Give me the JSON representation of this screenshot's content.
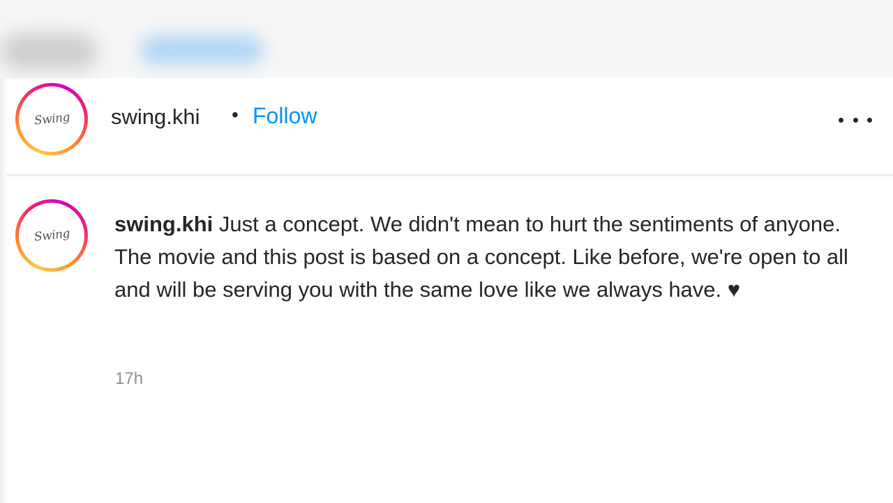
{
  "header": {
    "username": "swing.khi",
    "separator": "•",
    "follow_label": "Follow",
    "more_icon": "more-horizontal-icon",
    "avatar_logo_text": "Swing"
  },
  "comment": {
    "username": "swing.khi",
    "text": "Just a concept. We didn't mean to hurt the sentiments of anyone. The movie and this post is based on a concept. Like before, we're open to all and will be serving you with the same love like we always have. ♥",
    "timestamp": "17h",
    "avatar_logo_text": "Swing"
  },
  "colors": {
    "accent_link": "#0095f6",
    "text_primary": "#262626",
    "text_secondary": "#8e8e8e"
  }
}
